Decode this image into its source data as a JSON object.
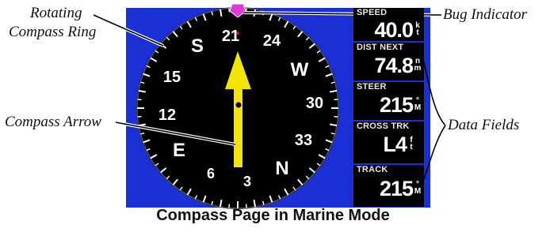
{
  "callouts": {
    "rotating_ring": "Rotating\nCompass Ring",
    "rotating_ring_line1": "Rotating",
    "rotating_ring_line2": "Compass Ring",
    "compass_arrow": "Compass Arrow",
    "bug_indicator": "Bug Indicator",
    "data_fields": "Data Fields"
  },
  "caption": "Compass Page in Marine Mode",
  "compass": {
    "heading_up": "21",
    "labels": [
      "S",
      "24",
      "W",
      "30",
      "33",
      "N",
      "3",
      "6",
      "E",
      "12",
      "15",
      "21"
    ],
    "top": "21",
    "l24": "24",
    "lW": "W",
    "l30": "30",
    "l33": "33",
    "lN": "N",
    "l3": "3",
    "l6": "6",
    "lE": "E",
    "l12": "12",
    "l15": "15",
    "lS": "S"
  },
  "data_fields": [
    {
      "label": "SPEED",
      "value": "40.0",
      "unit_top": "k",
      "unit_bottom": "t"
    },
    {
      "label": "DIST NEXT",
      "value": "74.8",
      "unit_top": "n",
      "unit_bottom": "m"
    },
    {
      "label": "STEER",
      "value": "215",
      "unit_top": "°",
      "unit_bottom": "M"
    },
    {
      "label": "CROSS TRK",
      "value": "L4",
      "unit_top": "f",
      "unit_bottom": "t"
    },
    {
      "label": "TRACK",
      "value": "215",
      "unit_top": "°",
      "unit_bottom": "M"
    }
  ],
  "colors": {
    "screen_bg": "#1a2fd4",
    "dial_bg": "#000000",
    "arrow": "#f2e600",
    "bug": "#e23ad6",
    "field_bg": "#000000"
  }
}
